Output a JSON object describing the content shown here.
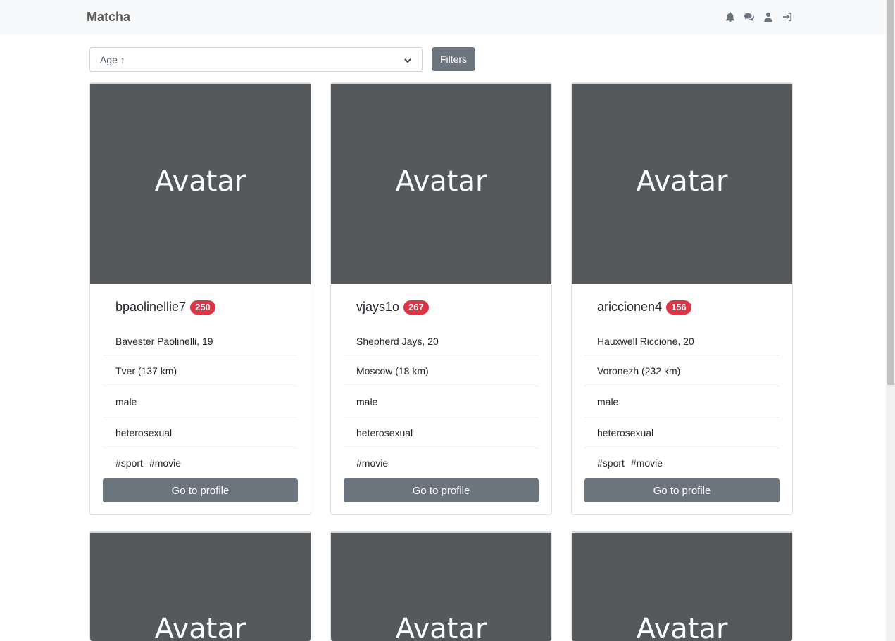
{
  "navbar": {
    "brand": "Matcha",
    "icons": [
      "bell-icon",
      "comments-icon",
      "user-icon",
      "sign-in-icon"
    ]
  },
  "controls": {
    "sort_value": "Age ↑",
    "filters_label": "Filters"
  },
  "cards": [
    {
      "avatar_text": "Avatar",
      "username": "bpaolinellie7",
      "rating": "250",
      "full_name_age": "Bavester Paolinelli, 19",
      "location": "Tver (137 km)",
      "gender": "male",
      "orientation": "heterosexual",
      "tags": [
        "#sport",
        "#movie"
      ],
      "button_label": "Go to profile"
    },
    {
      "avatar_text": "Avatar",
      "username": "vjays1o",
      "rating": "267",
      "full_name_age": "Shepherd Jays, 20",
      "location": "Moscow (18 km)",
      "gender": "male",
      "orientation": "heterosexual",
      "tags": [
        "#movie"
      ],
      "button_label": "Go to profile"
    },
    {
      "avatar_text": "Avatar",
      "username": "ariccionen4",
      "rating": "156",
      "full_name_age": "Hauxwell Riccione, 20",
      "location": "Voronezh (232 km)",
      "gender": "male",
      "orientation": "heterosexual",
      "tags": [
        "#sport",
        "#movie"
      ],
      "button_label": "Go to profile"
    },
    {
      "avatar_text": "Avatar"
    },
    {
      "avatar_text": "Avatar"
    },
    {
      "avatar_text": "Avatar"
    }
  ],
  "colors": {
    "avatar_bg": "#55595c",
    "badge": "#dc3545",
    "button": "#6c757d",
    "navbar_bg": "#f8f9fa"
  }
}
